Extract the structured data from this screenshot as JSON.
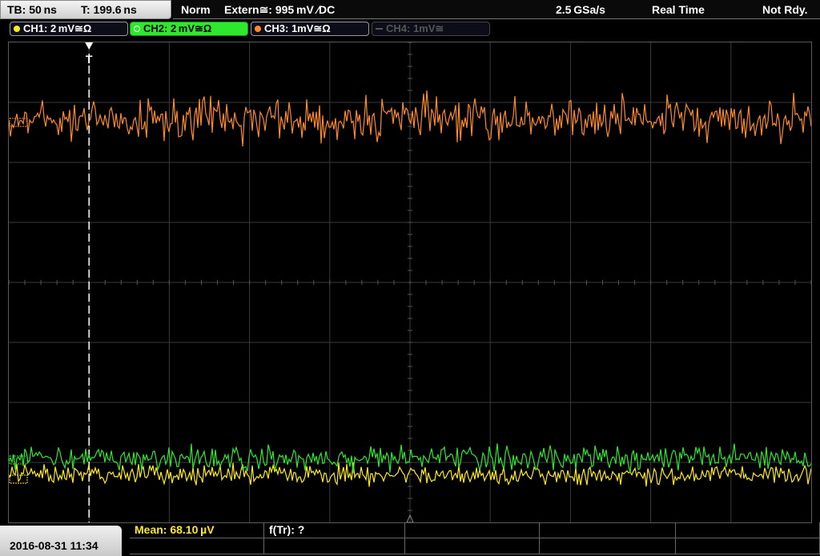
{
  "topbar": {
    "timebase": "TB: 50 ns",
    "trigger_time": "T: 199.6 ns",
    "acq_mode": "Norm",
    "trigger_source": "Extern≅: 995 mV ∕DC",
    "sample_rate": "2.5 GSa/s",
    "acq_type": "Real Time",
    "status": "Not Rdy."
  },
  "channels": [
    {
      "label": "CH1: 2 mV≅Ω",
      "color": "#ffeb1a",
      "state": "on"
    },
    {
      "label": "CH2: 2 mV≅Ω",
      "color": "#2ee82e",
      "state": "active"
    },
    {
      "label": "CH3: 1mV≅Ω",
      "color": "#ff8a2a",
      "state": "on"
    },
    {
      "label": "CH4: 1mV≅",
      "color": "#555555",
      "state": "off"
    }
  ],
  "trigger_marker": {
    "label": "T",
    "position_div": -4
  },
  "timestamp": "2016-08-31 11:34",
  "measurements": [
    {
      "label": "Mean: 68.10 µV",
      "color": "#ffeb1a"
    },
    {
      "label": "f(Tr): ?",
      "color": "#ffffff"
    }
  ],
  "colors": {
    "ch1": "#ffeb1a",
    "ch2": "#2ee82e",
    "ch3": "#ff8a2a",
    "grid": "#3a3a3a"
  }
}
